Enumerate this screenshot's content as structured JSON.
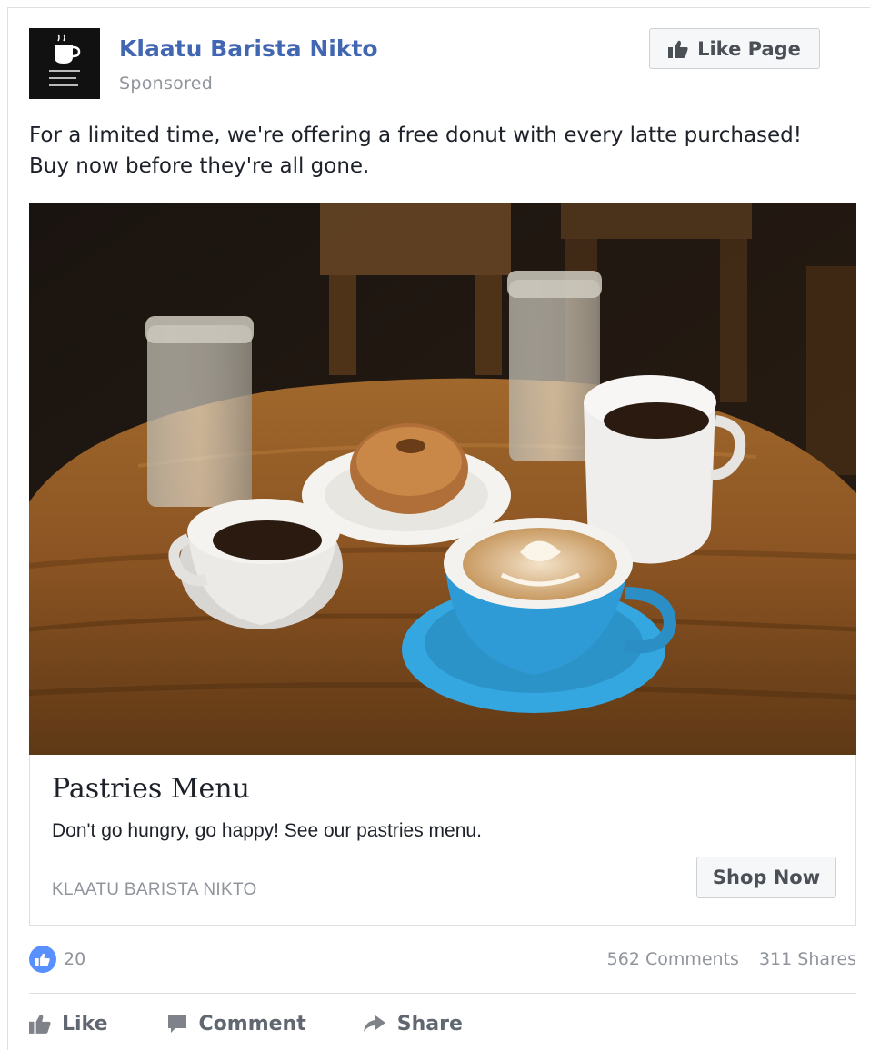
{
  "post": {
    "page_name": "Klaatu Barista Nikto",
    "sponsored_label": "Sponsored",
    "like_page_label": "Like Page",
    "text": "For a limited time, we're offering a free donut with every latte purchased! Buy now before they're all gone."
  },
  "link_card": {
    "title": "Pastries Menu",
    "description": "Don't go hungry, go happy! See our pastries menu.",
    "domain": "KLAATU BARISTA NIKTO",
    "cta_label": "Shop Now"
  },
  "stats": {
    "likes": "20",
    "comments": "562 Comments",
    "shares": "311 Shares"
  },
  "actions": {
    "like": "Like",
    "comment": "Comment",
    "share": "Share"
  },
  "colors": {
    "brand_blue": "#4267b2",
    "like_bubble": "#5890ff",
    "muted_text": "#90949c"
  },
  "icons": [
    "thumbs-up-icon",
    "comment-icon",
    "share-icon",
    "like-reaction-icon"
  ]
}
